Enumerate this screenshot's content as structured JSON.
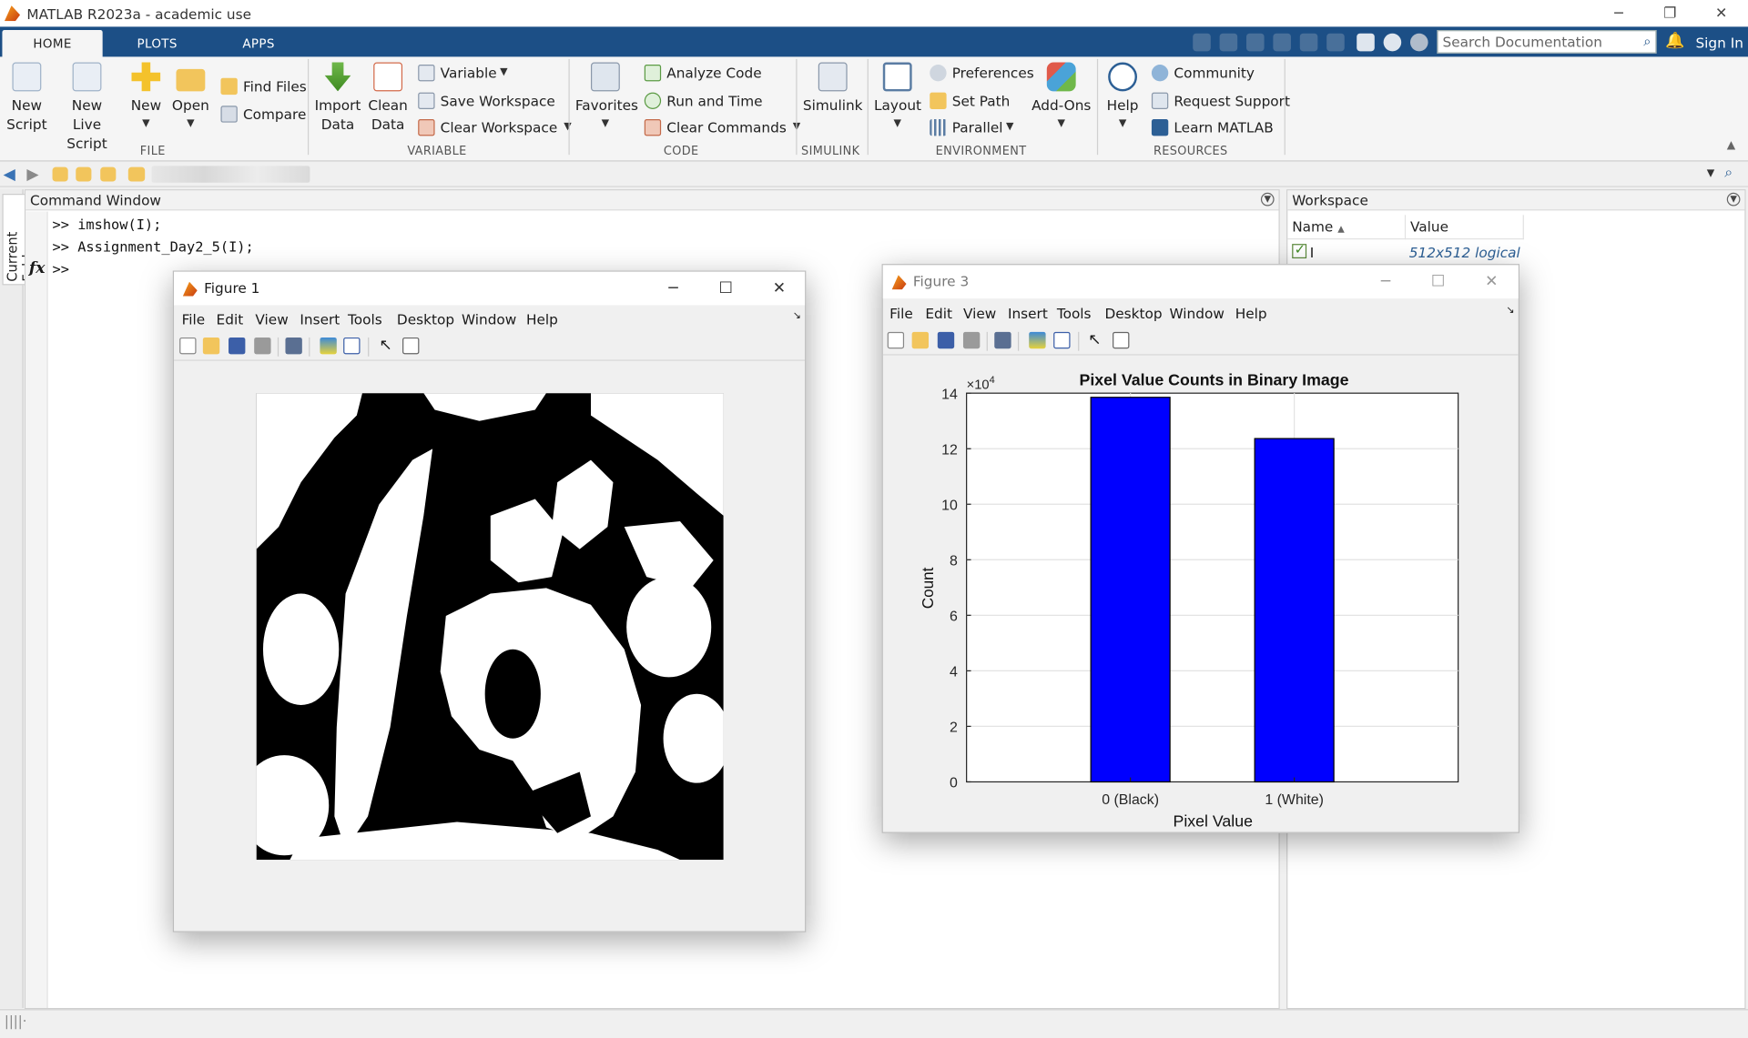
{
  "app": {
    "title": "MATLAB R2023a - academic use"
  },
  "tabs": [
    "HOME",
    "PLOTS",
    "APPS"
  ],
  "search": {
    "placeholder": "Search Documentation"
  },
  "signin": "Sign In",
  "ribbon": {
    "file": {
      "new_script": [
        "New",
        "Script"
      ],
      "new_live_script": [
        "New",
        "Live Script"
      ],
      "new": "New",
      "open": "Open",
      "find_files": "Find Files",
      "compare": "Compare",
      "group": "FILE"
    },
    "variable": {
      "import_data": [
        "Import",
        "Data"
      ],
      "clean_data": [
        "Clean",
        "Data"
      ],
      "variable": "Variable",
      "save_workspace": "Save Workspace",
      "clear_workspace": "Clear Workspace",
      "group": "VARIABLE"
    },
    "code": {
      "favorites": "Favorites",
      "analyze_code": "Analyze Code",
      "run_and_time": "Run and Time",
      "clear_commands": "Clear Commands",
      "group": "CODE"
    },
    "simulink": {
      "simulink": "Simulink",
      "group": "SIMULINK"
    },
    "environment": {
      "layout": "Layout",
      "preferences": "Preferences",
      "set_path": "Set Path",
      "parallel": "Parallel",
      "add_ons": "Add-Ons",
      "group": "ENVIRONMENT"
    },
    "resources": {
      "help": "Help",
      "community": "Community",
      "request_support": "Request Support",
      "learn_matlab": "Learn MATLAB",
      "group": "RESOURCES"
    }
  },
  "sidebar": {
    "current_folder": "Current Folder"
  },
  "command_window": {
    "title": "Command Window",
    "lines": [
      ">> imshow(I);",
      ">> Assignment_Day2_5(I);"
    ],
    "prompt": ">>",
    "fx": "fx"
  },
  "workspace": {
    "title": "Workspace",
    "col_name": "Name",
    "col_value": "Value",
    "rows": [
      {
        "name": "I",
        "value": "512x512 logical"
      }
    ]
  },
  "figure1": {
    "title": "Figure 1",
    "menu": [
      "File",
      "Edit",
      "View",
      "Insert",
      "Tools",
      "Desktop",
      "Window",
      "Help"
    ]
  },
  "figure3": {
    "title": "Figure 3",
    "menu": [
      "File",
      "Edit",
      "View",
      "Insert",
      "Tools",
      "Desktop",
      "Window",
      "Help"
    ]
  },
  "colors": {
    "bar": "#0000ff",
    "ribbon_blue": "#1c4f86"
  },
  "chart_data": {
    "type": "bar",
    "title": "Pixel Value Counts in Binary Image",
    "xlabel": "Pixel Value",
    "ylabel": "Count",
    "categories": [
      "0 (Black)",
      "1 (White)"
    ],
    "values": [
      138500,
      123644
    ],
    "ylim": [
      0,
      140000
    ],
    "yticks": [
      "0",
      "2",
      "4",
      "6",
      "8",
      "10",
      "12",
      "14"
    ],
    "exponent": "×10",
    "exponent_power": "4",
    "grid": true
  }
}
